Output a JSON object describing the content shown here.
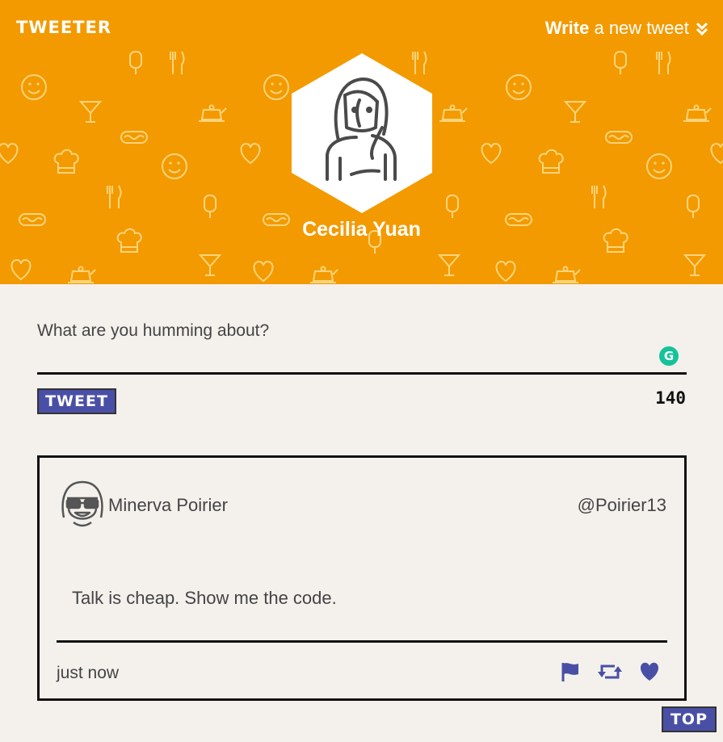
{
  "app": {
    "logo": "TWEETER"
  },
  "header": {
    "compose_toggle_bold": "Write",
    "compose_toggle_rest": " a new tweet",
    "profile_name": "Cecilia Yuan",
    "background_color": "#f39a00"
  },
  "composer": {
    "placeholder": "What are you humming about?",
    "value": "",
    "tweet_button_label": "TWEET",
    "char_counter": "140"
  },
  "tweets": [
    {
      "author_name": "Minerva Poirier",
      "author_handle": "@Poirier13",
      "text": "Talk is cheap. Show me the code.",
      "timestamp": "just now",
      "actions": [
        "flag-icon",
        "retweet-icon",
        "heart-icon"
      ]
    }
  ],
  "top_button_label": "TOP",
  "colors": {
    "accent": "#4a4fa6",
    "header": "#f39a00",
    "background": "#f4f1ed",
    "grammarly": "#15c39a"
  }
}
